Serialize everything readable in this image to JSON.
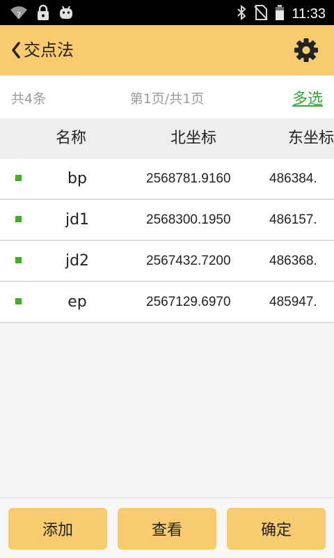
{
  "status_bar": {
    "time": "11:33",
    "icons": [
      "wifi-unknown-icon",
      "lock-icon",
      "android-icon",
      "bluetooth-icon",
      "no-sim-icon",
      "battery-icon"
    ]
  },
  "app_bar": {
    "title": "交点法",
    "back_icon": "chevron-left-icon",
    "settings_icon": "gear-icon",
    "background": "#f7cb6e"
  },
  "summary": {
    "count": "共4条",
    "page": "第1页/共1页",
    "multi_select": "多选",
    "multi_select_color": "#37a53a"
  },
  "table": {
    "headers": [
      "名称",
      "北坐标",
      "东坐标"
    ],
    "rows": [
      {
        "name": "bp",
        "north": "2568781.9160",
        "east": "486384."
      },
      {
        "name": "jd1",
        "north": "2568300.1950",
        "east": "486157."
      },
      {
        "name": "jd2",
        "north": "2567432.7200",
        "east": "486368."
      },
      {
        "name": "ep",
        "north": "2567129.6970",
        "east": "485947."
      }
    ],
    "marker_color": "#3fae29"
  },
  "buttons": {
    "add": "添加",
    "view": "查看",
    "confirm": "确定"
  }
}
